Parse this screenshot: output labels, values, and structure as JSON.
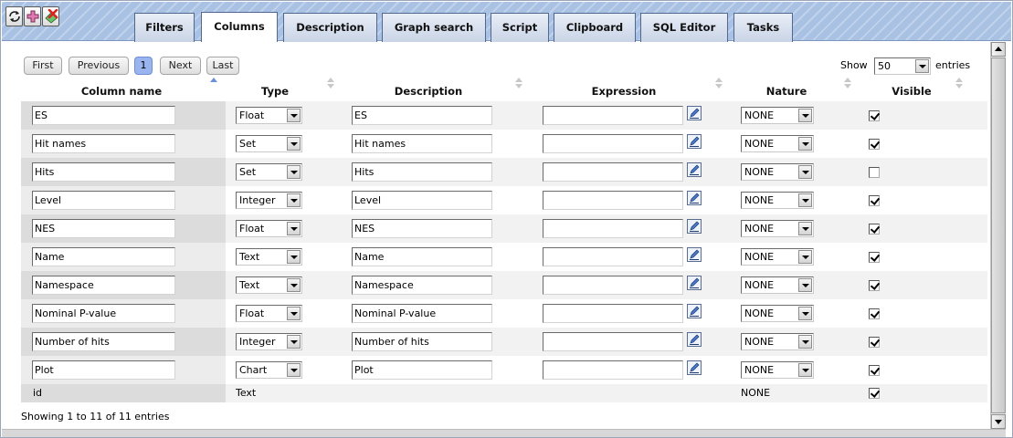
{
  "colors": {
    "tabbar": "#a9c1e3",
    "current_page": "#9ab4f0",
    "row_alt": "#f2f2f2"
  },
  "toolbar": {
    "refresh_icon": "refresh-icon",
    "add_icon": "add-icon",
    "delete_icon": "delete-icon"
  },
  "tabs": [
    "Filters",
    "Columns",
    "Description",
    "Graph search",
    "Script",
    "Clipboard",
    "SQL Editor",
    "Tasks"
  ],
  "active_tab": "Columns",
  "pager": {
    "first": "First",
    "previous": "Previous",
    "current": "1",
    "next": "Next",
    "last": "Last"
  },
  "length": {
    "show_label": "Show",
    "value": "50",
    "entries_label": "entries"
  },
  "headers": {
    "name": "Column name",
    "type": "Type",
    "description": "Description",
    "expression": "Expression",
    "nature": "Nature",
    "visible": "Visible"
  },
  "rows": [
    {
      "name": "ES",
      "type": "Float",
      "description": "ES",
      "expression": "",
      "nature": "NONE",
      "visible": true
    },
    {
      "name": "Hit names",
      "type": "Set",
      "description": "Hit names",
      "expression": "",
      "nature": "NONE",
      "visible": true
    },
    {
      "name": "Hits",
      "type": "Set",
      "description": "Hits",
      "expression": "",
      "nature": "NONE",
      "visible": false
    },
    {
      "name": "Level",
      "type": "Integer",
      "description": "Level",
      "expression": "",
      "nature": "NONE",
      "visible": true
    },
    {
      "name": "NES",
      "type": "Float",
      "description": "NES",
      "expression": "",
      "nature": "NONE",
      "visible": true
    },
    {
      "name": "Name",
      "type": "Text",
      "description": "Name",
      "expression": "",
      "nature": "NONE",
      "visible": true
    },
    {
      "name": "Namespace",
      "type": "Text",
      "description": "Namespace",
      "expression": "",
      "nature": "NONE",
      "visible": true
    },
    {
      "name": "Nominal P-value",
      "type": "Float",
      "description": "Nominal P-value",
      "expression": "",
      "nature": "NONE",
      "visible": true
    },
    {
      "name": "Number of hits",
      "type": "Integer",
      "description": "Number of hits",
      "expression": "",
      "nature": "NONE",
      "visible": true
    },
    {
      "name": "Plot",
      "type": "Chart",
      "description": "Plot",
      "expression": "",
      "nature": "NONE",
      "visible": true
    }
  ],
  "id_row": {
    "name": "id",
    "type": "Text",
    "nature": "NONE",
    "visible": true
  },
  "info": "Showing 1 to 11 of 11 entries"
}
